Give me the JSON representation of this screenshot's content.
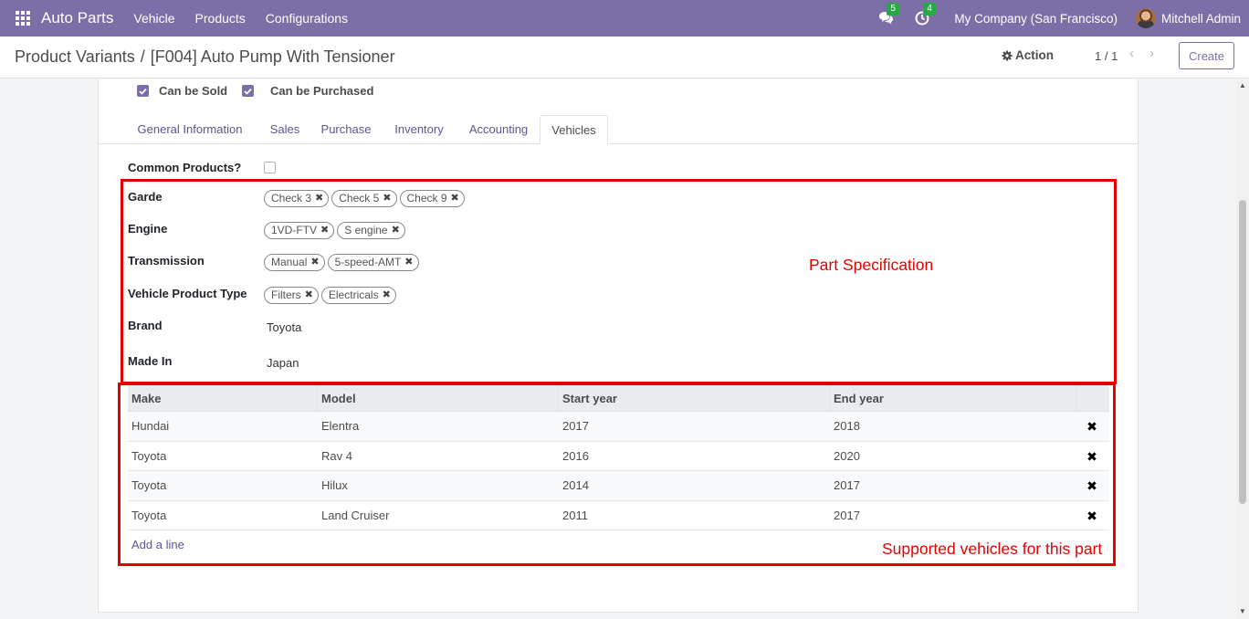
{
  "navbar": {
    "brand": "Auto Parts",
    "menu": [
      "Vehicle",
      "Products",
      "Configurations"
    ],
    "messages_count": "5",
    "activities_count": "4",
    "company": "My Company (San Francisco)",
    "user": "Mitchell Admin"
  },
  "control": {
    "breadcrumb_parent": "Product Variants",
    "breadcrumb_sep": "/",
    "breadcrumb_current": "[F004] Auto Pump With Tensioner",
    "action_label": "Action",
    "pager": "1 / 1",
    "create_label": "Create"
  },
  "form": {
    "can_be_sold": {
      "label": "Can be Sold",
      "checked": true
    },
    "can_be_purchased": {
      "label": "Can be Purchased",
      "checked": true
    },
    "tabs": [
      "General Information",
      "Sales",
      "Purchase",
      "Inventory",
      "Accounting",
      "Vehicles"
    ],
    "active_tab": "Vehicles",
    "common_products": {
      "label": "Common Products?",
      "checked": false
    },
    "fields": {
      "garde": {
        "label": "Garde",
        "tags": [
          "Check 3",
          "Check 5",
          "Check 9"
        ]
      },
      "engine": {
        "label": "Engine",
        "tags": [
          "1VD-FTV",
          "S engine"
        ]
      },
      "transmission": {
        "label": "Transmission",
        "tags": [
          "Manual",
          "5-speed-AMT"
        ]
      },
      "vehicle_product_type": {
        "label": "Vehicle Product Type",
        "tags": [
          "Filters",
          "Electricals"
        ]
      },
      "brand": {
        "label": "Brand",
        "value": "Toyota"
      },
      "made_in": {
        "label": "Made In",
        "value": "Japan"
      }
    },
    "table": {
      "headers": [
        "Make",
        "Model",
        "Start year",
        "End year"
      ],
      "rows": [
        [
          "Hundai",
          "Elentra",
          "2017",
          "2018"
        ],
        [
          "Toyota",
          "Rav 4",
          "2016",
          "2020"
        ],
        [
          "Toyota",
          "Hilux",
          "2014",
          "2017"
        ],
        [
          "Toyota",
          "Land Cruiser",
          "2011",
          "2017"
        ]
      ],
      "add_line": "Add a line"
    }
  },
  "annotations": {
    "part_spec": "Part Specification",
    "supported": "Supported vehicles for this part",
    "color": "#e60000"
  },
  "colors": {
    "primary": "#7c6ea6",
    "link": "#5e5392"
  }
}
